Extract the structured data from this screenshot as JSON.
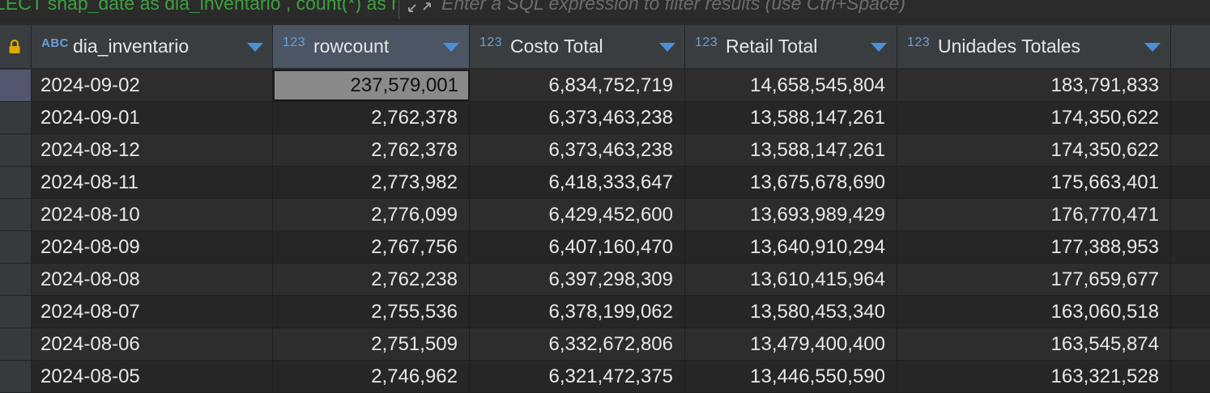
{
  "query": {
    "sql_text": "LECT snap_date as dia_inventario , count(*) as rowcount",
    "filter_placeholder": "Enter a SQL expression to filter results (use Ctrl+Space)"
  },
  "columns": [
    {
      "type_badge": "ABC",
      "name": "dia_inventario"
    },
    {
      "type_badge": "123",
      "name": "rowcount"
    },
    {
      "type_badge": "123",
      "name": "Costo Total"
    },
    {
      "type_badge": "123",
      "name": "Retail Total"
    },
    {
      "type_badge": "123",
      "name": "Unidades Totales"
    }
  ],
  "rows": [
    [
      "2024-09-02",
      "237,579,001",
      "6,834,752,719",
      "14,658,545,804",
      "183,791,833"
    ],
    [
      "2024-09-01",
      "2,762,378",
      "6,373,463,238",
      "13,588,147,261",
      "174,350,622"
    ],
    [
      "2024-08-12",
      "2,762,378",
      "6,373,463,238",
      "13,588,147,261",
      "174,350,622"
    ],
    [
      "2024-08-11",
      "2,773,982",
      "6,418,333,647",
      "13,675,678,690",
      "175,663,401"
    ],
    [
      "2024-08-10",
      "2,776,099",
      "6,429,452,600",
      "13,693,989,429",
      "176,770,471"
    ],
    [
      "2024-08-09",
      "2,767,756",
      "6,407,160,470",
      "13,640,910,294",
      "177,388,953"
    ],
    [
      "2024-08-08",
      "2,762,238",
      "6,397,298,309",
      "13,610,415,964",
      "177,659,677"
    ],
    [
      "2024-08-07",
      "2,755,536",
      "6,378,199,062",
      "13,580,453,340",
      "163,060,518"
    ],
    [
      "2024-08-06",
      "2,751,509",
      "6,332,672,806",
      "13,479,400,400",
      "163,545,874"
    ],
    [
      "2024-08-05",
      "2,746,962",
      "6,321,472,375",
      "13,446,550,590",
      "163,321,528"
    ]
  ],
  "selection": {
    "row": 0,
    "column": 1
  },
  "colors": {
    "sql_text": "#3f9f3f",
    "type_badge": "#6b9fd6",
    "sort_arrow": "#4a90d9",
    "header_bg": "#3a3d40",
    "focused_cell": "#8a8a8a"
  },
  "icons": {
    "lock": "lock-icon",
    "expand": "expand-icon",
    "sort": "sort-arrow-icon"
  }
}
